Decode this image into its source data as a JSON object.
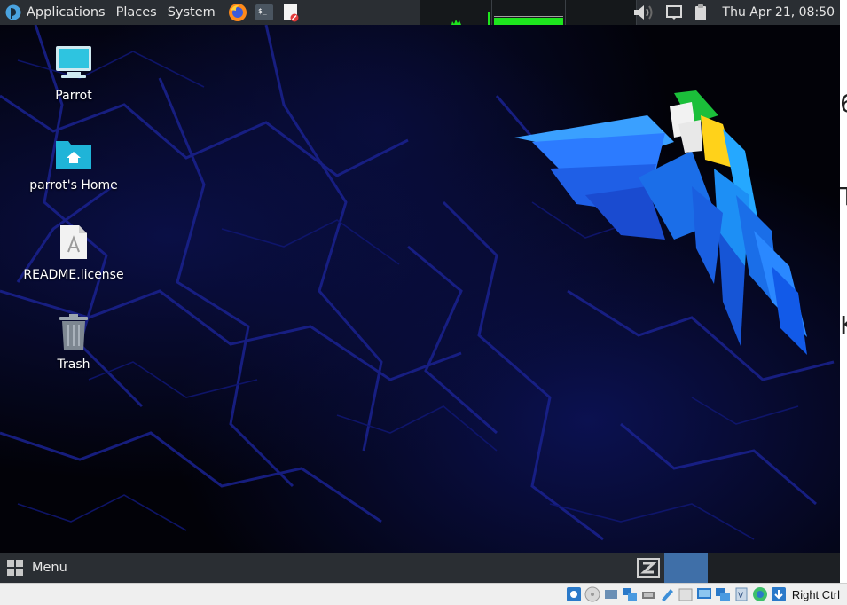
{
  "top_panel": {
    "menus": {
      "applications": "Applications",
      "places": "Places",
      "system": "System"
    },
    "launchers": [
      "firefox-icon",
      "terminal-icon",
      "text-editor-icon"
    ],
    "clock": "Thu Apr 21, 08:50",
    "tray": [
      "volume-icon",
      "screen-icon",
      "clipboard-icon"
    ]
  },
  "desktop": {
    "icons": [
      {
        "label": "Parrot",
        "icon": "computer-icon"
      },
      {
        "label": "parrot's Home",
        "icon": "home-folder-icon"
      },
      {
        "label": "README.license",
        "icon": "license-file-icon"
      },
      {
        "label": "Trash",
        "icon": "trash-icon"
      }
    ]
  },
  "bottom_panel": {
    "menu_label": "Menu",
    "menu_icon": "grid-icon"
  },
  "vbox_status": {
    "host_key": "Right Ctrl"
  },
  "colors": {
    "panel": "#2a2e33",
    "workspace_active": "#3f6fa8",
    "annotation_arrow": "#cc1b1b",
    "monitor_green": "#1ee61e"
  }
}
